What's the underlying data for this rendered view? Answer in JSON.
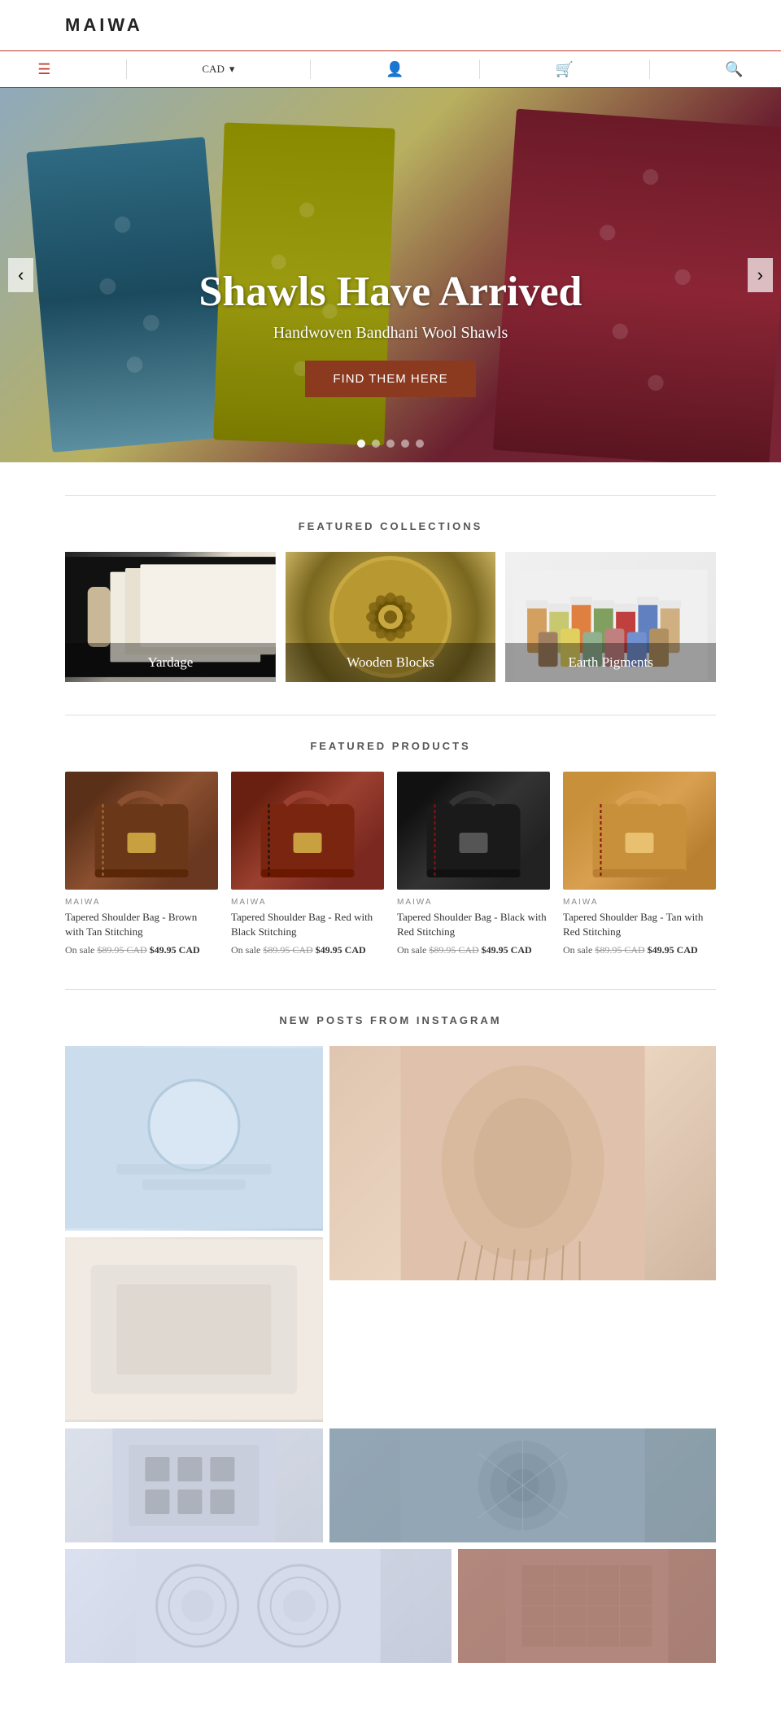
{
  "header": {
    "logo": "MAIWA"
  },
  "nav": {
    "menu_label": "☰",
    "currency": "CAD",
    "currency_arrow": "▾",
    "account_icon": "account",
    "cart_icon": "cart",
    "search_icon": "search"
  },
  "hero": {
    "title": "Shawls Have Arrived",
    "subtitle": "Handwoven Bandhani Wool Shawls",
    "cta_label": "FIND THEM HERE",
    "arrow_left": "‹",
    "arrow_right": "›",
    "dots": [
      1,
      2,
      3,
      4,
      5
    ]
  },
  "featured_collections": {
    "section_title": "FEATURED COLLECTIONS",
    "items": [
      {
        "label": "Yardage"
      },
      {
        "label": "Wooden Blocks"
      },
      {
        "label": "Earth Pigments"
      }
    ]
  },
  "featured_products": {
    "section_title": "FEATURED PRODUCTS",
    "items": [
      {
        "brand": "MAIWA",
        "name": "Tapered Shoulder Bag - Brown with Tan Stitching",
        "sale_label": "On sale",
        "original_price": "$89.95 CAD",
        "sale_price": "$49.95 CAD"
      },
      {
        "brand": "MAIWA",
        "name": "Tapered Shoulder Bag - Red with Black Stitching",
        "sale_label": "On sale",
        "original_price": "$89.95 CAD",
        "sale_price": "$49.95 CAD"
      },
      {
        "brand": "MAIWA",
        "name": "Tapered Shoulder Bag - Black with Red Stitching",
        "sale_label": "On sale",
        "original_price": "$89.95 CAD",
        "sale_price": "$49.95 CAD"
      },
      {
        "brand": "MAIWA",
        "name": "Tapered Shoulder Bag - Tan with Red Stitching",
        "sale_label": "On sale",
        "original_price": "$89.95 CAD",
        "sale_price": "$49.95 CAD"
      }
    ]
  },
  "instagram": {
    "section_title": "NEW POSTS FROM INSTAGRAM"
  }
}
